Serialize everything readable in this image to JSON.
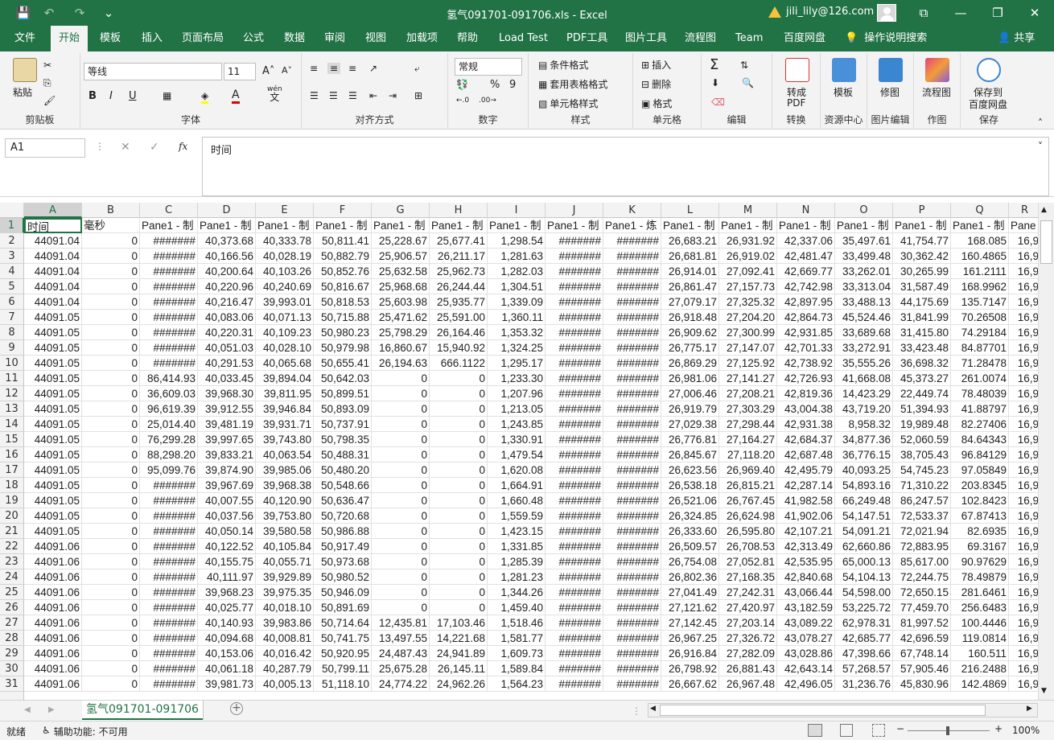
{
  "window": {
    "title": "氢气091701-091706.xls  -  Excel",
    "user_warning": "⚠",
    "user_email": "jili_lily@126.com",
    "qa_save": "💾",
    "qa_undo": "↶",
    "qa_redo": "↷",
    "qa_more": "⌄",
    "ribbon_display": "⧉",
    "minimize": "—",
    "restore": "❐",
    "close": "✕"
  },
  "tabs": [
    "文件",
    "开始",
    "模板",
    "插入",
    "页面布局",
    "公式",
    "数据",
    "审阅",
    "视图",
    "加载项",
    "帮助",
    "Load Test",
    "PDF工具",
    "图片工具",
    "流程图",
    "Team",
    "百度网盘"
  ],
  "tell_me": "操作说明搜索",
  "share": "共享",
  "ribbon": {
    "clipboard": {
      "paste": "粘贴",
      "label": "剪贴板"
    },
    "font": {
      "name": "等线",
      "size": "11",
      "grow": "A˄",
      "shrink": "A˅",
      "bold": "B",
      "italic": "I",
      "underline": "U",
      "font_color": "A",
      "wen": "wén",
      "wen_char": "文",
      "label": "字体"
    },
    "alignment": {
      "label": "对齐方式"
    },
    "number": {
      "format": "常规",
      "percent": "%",
      "comma": "9",
      "label": "数字"
    },
    "styles": {
      "conditional": "条件格式",
      "table": "套用表格格式",
      "cell_styles": "单元格样式",
      "label": "样式"
    },
    "cells": {
      "insert": "插入",
      "delete": "删除",
      "format": "格式",
      "label": "单元格"
    },
    "editing": {
      "sum": "Σ",
      "label": "编辑"
    },
    "convert": {
      "btn1": "转成",
      "btn2": "PDF",
      "label": "转换"
    },
    "templates": {
      "btn": "模板",
      "label": "资源中心"
    },
    "repair": {
      "btn": "修图",
      "label": "图片编辑"
    },
    "flow": {
      "btn": "流程图",
      "label": "作图"
    },
    "save": {
      "btn1": "保存到",
      "btn2": "百度网盘",
      "label": "保存"
    }
  },
  "formula_bar": {
    "name_box": "A1",
    "cancel": "✕",
    "enter": "✓",
    "fx": "fx",
    "content": "时间"
  },
  "columns": [
    "A",
    "B",
    "C",
    "D",
    "E",
    "F",
    "G",
    "H",
    "I",
    "J",
    "K",
    "L",
    "M",
    "N",
    "O",
    "P",
    "Q",
    "R"
  ],
  "header_row": [
    "时间",
    "毫秒",
    "Pane1 - 制",
    "Pane1 - 制",
    "Pane1 - 制",
    "Pane1 - 制",
    "Pane1 - 制",
    "Pane1 - 制",
    "Pane1 - 制",
    "Pane1 - 制",
    "Pane1 - 炼",
    "Pane1 - 制",
    "Pane1 - 制",
    "Pane1 - 制",
    "Pane1 - 制",
    "Pane1 - 制",
    "Pane1 - 制",
    "Pane"
  ],
  "rows": [
    [
      "44091.04",
      "0",
      "#######",
      "40,373.68",
      "40,333.78",
      "50,811.41",
      "25,228.67",
      "25,677.41",
      "1,298.54",
      "#######",
      "#######",
      "26,683.21",
      "26,931.92",
      "42,337.06",
      "35,497.61",
      "41,754.77",
      "168.085",
      "16,9"
    ],
    [
      "44091.04",
      "0",
      "#######",
      "40,166.56",
      "40,028.19",
      "50,882.79",
      "25,906.57",
      "26,211.17",
      "1,281.63",
      "#######",
      "#######",
      "26,681.81",
      "26,919.02",
      "42,481.47",
      "33,499.48",
      "30,362.42",
      "160.4865",
      "16,9"
    ],
    [
      "44091.04",
      "0",
      "#######",
      "40,200.64",
      "40,103.26",
      "50,852.76",
      "25,632.58",
      "25,962.73",
      "1,282.03",
      "#######",
      "#######",
      "26,914.01",
      "27,092.41",
      "42,669.77",
      "33,262.01",
      "30,265.99",
      "161.2111",
      "16,9"
    ],
    [
      "44091.04",
      "0",
      "#######",
      "40,220.96",
      "40,240.69",
      "50,816.67",
      "25,968.68",
      "26,244.44",
      "1,304.51",
      "#######",
      "#######",
      "26,861.47",
      "27,157.73",
      "42,742.98",
      "33,313.04",
      "31,587.49",
      "168.9962",
      "16,9"
    ],
    [
      "44091.04",
      "0",
      "#######",
      "40,216.47",
      "39,993.01",
      "50,818.53",
      "25,603.98",
      "25,935.77",
      "1,339.09",
      "#######",
      "#######",
      "27,079.17",
      "27,325.32",
      "42,897.95",
      "33,488.13",
      "44,175.69",
      "135.7147",
      "16,9"
    ],
    [
      "44091.05",
      "0",
      "#######",
      "40,083.06",
      "40,071.13",
      "50,715.88",
      "25,471.62",
      "25,591.00",
      "1,360.11",
      "#######",
      "#######",
      "26,918.48",
      "27,204.20",
      "42,864.73",
      "45,524.46",
      "31,841.99",
      "70.26508",
      "16,9"
    ],
    [
      "44091.05",
      "0",
      "#######",
      "40,220.31",
      "40,109.23",
      "50,980.23",
      "25,798.29",
      "26,164.46",
      "1,353.32",
      "#######",
      "#######",
      "26,909.62",
      "27,300.99",
      "42,931.85",
      "33,689.68",
      "31,415.80",
      "74.29184",
      "16,9"
    ],
    [
      "44091.05",
      "0",
      "#######",
      "40,051.03",
      "40,028.10",
      "50,979.98",
      "16,860.67",
      "15,940.92",
      "1,324.25",
      "#######",
      "#######",
      "26,775.17",
      "27,147.07",
      "42,701.33",
      "33,272.91",
      "33,423.48",
      "84.87701",
      "16,9"
    ],
    [
      "44091.05",
      "0",
      "#######",
      "40,291.53",
      "40,065.68",
      "50,655.41",
      "26,194.63",
      "666.1122",
      "1,295.17",
      "#######",
      "#######",
      "26,869.29",
      "27,125.92",
      "42,738.92",
      "35,555.26",
      "36,698.32",
      "71.28478",
      "16,9"
    ],
    [
      "44091.05",
      "0",
      "86,414.93",
      "40,033.45",
      "39,894.04",
      "50,642.03",
      "0",
      "0",
      "1,233.30",
      "#######",
      "#######",
      "26,981.06",
      "27,141.27",
      "42,726.93",
      "41,668.08",
      "45,373.27",
      "261.0074",
      "16,9"
    ],
    [
      "44091.05",
      "0",
      "36,609.03",
      "39,968.30",
      "39,811.95",
      "50,899.51",
      "0",
      "0",
      "1,207.96",
      "#######",
      "#######",
      "27,006.46",
      "27,208.21",
      "42,819.36",
      "14,423.29",
      "22,449.74",
      "78.48039",
      "16,9"
    ],
    [
      "44091.05",
      "0",
      "96,619.39",
      "39,912.55",
      "39,946.84",
      "50,893.09",
      "0",
      "0",
      "1,213.05",
      "#######",
      "#######",
      "26,919.79",
      "27,303.29",
      "43,004.38",
      "43,719.20",
      "51,394.93",
      "41.88797",
      "16,9"
    ],
    [
      "44091.05",
      "0",
      "25,014.40",
      "39,481.19",
      "39,931.71",
      "50,737.91",
      "0",
      "0",
      "1,243.85",
      "#######",
      "#######",
      "27,029.38",
      "27,298.44",
      "42,931.38",
      "8,958.32",
      "19,989.48",
      "82.27406",
      "16,9"
    ],
    [
      "44091.05",
      "0",
      "76,299.28",
      "39,997.65",
      "39,743.80",
      "50,798.35",
      "0",
      "0",
      "1,330.91",
      "#######",
      "#######",
      "26,776.81",
      "27,164.27",
      "42,684.37",
      "34,877.36",
      "52,060.59",
      "84.64343",
      "16,9"
    ],
    [
      "44091.05",
      "0",
      "88,298.20",
      "39,833.21",
      "40,063.54",
      "50,488.31",
      "0",
      "0",
      "1,479.54",
      "#######",
      "#######",
      "26,845.67",
      "27,118.20",
      "42,687.48",
      "36,776.15",
      "38,705.43",
      "96.84129",
      "16,9"
    ],
    [
      "44091.05",
      "0",
      "95,099.76",
      "39,874.90",
      "39,985.06",
      "50,480.20",
      "0",
      "0",
      "1,620.08",
      "#######",
      "#######",
      "26,623.56",
      "26,969.40",
      "42,495.79",
      "40,093.25",
      "54,745.23",
      "97.05849",
      "16,9"
    ],
    [
      "44091.05",
      "0",
      "#######",
      "39,967.69",
      "39,968.38",
      "50,548.66",
      "0",
      "0",
      "1,664.91",
      "#######",
      "#######",
      "26,538.18",
      "26,815.21",
      "42,287.14",
      "54,893.16",
      "71,310.22",
      "203.8345",
      "16,9"
    ],
    [
      "44091.05",
      "0",
      "#######",
      "40,007.55",
      "40,120.90",
      "50,636.47",
      "0",
      "0",
      "1,660.48",
      "#######",
      "#######",
      "26,521.06",
      "26,767.45",
      "41,982.58",
      "66,249.48",
      "86,247.57",
      "102.8423",
      "16,9"
    ],
    [
      "44091.05",
      "0",
      "#######",
      "40,037.56",
      "39,753.80",
      "50,720.68",
      "0",
      "0",
      "1,559.59",
      "#######",
      "#######",
      "26,324.85",
      "26,624.98",
      "41,902.06",
      "54,147.51",
      "72,533.37",
      "67.87413",
      "16,9"
    ],
    [
      "44091.05",
      "0",
      "#######",
      "40,050.14",
      "39,580.58",
      "50,986.88",
      "0",
      "0",
      "1,423.15",
      "#######",
      "#######",
      "26,333.60",
      "26,595.80",
      "42,107.21",
      "54,091.21",
      "72,021.94",
      "82.6935",
      "16,9"
    ],
    [
      "44091.06",
      "0",
      "#######",
      "40,122.52",
      "40,105.84",
      "50,917.49",
      "0",
      "0",
      "1,331.85",
      "#######",
      "#######",
      "26,509.57",
      "26,708.53",
      "42,313.49",
      "62,660.86",
      "72,883.95",
      "69.3167",
      "16,9"
    ],
    [
      "44091.06",
      "0",
      "#######",
      "40,155.75",
      "40,055.71",
      "50,973.68",
      "0",
      "0",
      "1,285.39",
      "#######",
      "#######",
      "26,754.08",
      "27,052.81",
      "42,535.95",
      "65,000.13",
      "85,617.00",
      "90.97629",
      "16,9"
    ],
    [
      "44091.06",
      "0",
      "#######",
      "40,111.97",
      "39,929.89",
      "50,980.52",
      "0",
      "0",
      "1,281.23",
      "#######",
      "#######",
      "26,802.36",
      "27,168.35",
      "42,840.68",
      "54,104.13",
      "72,244.75",
      "78.49879",
      "16,9"
    ],
    [
      "44091.06",
      "0",
      "#######",
      "39,968.23",
      "39,975.35",
      "50,946.09",
      "0",
      "0",
      "1,344.26",
      "#######",
      "#######",
      "27,041.49",
      "27,242.31",
      "43,066.44",
      "54,598.00",
      "72,650.15",
      "281.6461",
      "16,9"
    ],
    [
      "44091.06",
      "0",
      "#######",
      "40,025.77",
      "40,018.10",
      "50,891.69",
      "0",
      "0",
      "1,459.40",
      "#######",
      "#######",
      "27,121.62",
      "27,420.97",
      "43,182.59",
      "53,225.72",
      "77,459.70",
      "256.6483",
      "16,9"
    ],
    [
      "44091.06",
      "0",
      "#######",
      "40,140.93",
      "39,983.86",
      "50,714.64",
      "12,435.81",
      "17,103.46",
      "1,518.46",
      "#######",
      "#######",
      "27,142.45",
      "27,203.14",
      "43,089.22",
      "62,978.31",
      "81,997.52",
      "100.4446",
      "16,9"
    ],
    [
      "44091.06",
      "0",
      "#######",
      "40,094.68",
      "40,008.81",
      "50,741.75",
      "13,497.55",
      "14,221.68",
      "1,581.77",
      "#######",
      "#######",
      "26,967.25",
      "27,326.72",
      "43,078.27",
      "42,685.77",
      "42,696.59",
      "119.0814",
      "16,9"
    ],
    [
      "44091.06",
      "0",
      "#######",
      "40,153.06",
      "40,016.42",
      "50,920.95",
      "24,487.43",
      "24,941.89",
      "1,609.73",
      "#######",
      "#######",
      "26,916.84",
      "27,282.09",
      "43,028.86",
      "47,398.66",
      "67,748.14",
      "160.511",
      "16,9"
    ],
    [
      "44091.06",
      "0",
      "#######",
      "40,061.18",
      "40,287.79",
      "50,799.11",
      "25,675.28",
      "26,145.11",
      "1,589.84",
      "#######",
      "#######",
      "26,798.92",
      "26,881.43",
      "42,643.14",
      "57,268.57",
      "57,905.46",
      "216.2488",
      "16,9"
    ],
    [
      "44091.06",
      "0",
      "#######",
      "39,981.73",
      "40,005.13",
      "51,118.10",
      "24,774.22",
      "24,962.26",
      "1,564.23",
      "#######",
      "#######",
      "26,667.62",
      "26,967.48",
      "42,496.05",
      "31,236.76",
      "45,830.96",
      "142.4869",
      "16,9"
    ]
  ],
  "sheet_tab": "氢气091701-091706",
  "status": {
    "ready": "就绪",
    "accessibility": "辅助功能: 不可用",
    "zoom": "100%",
    "zoom_minus": "−",
    "zoom_plus": "+"
  }
}
